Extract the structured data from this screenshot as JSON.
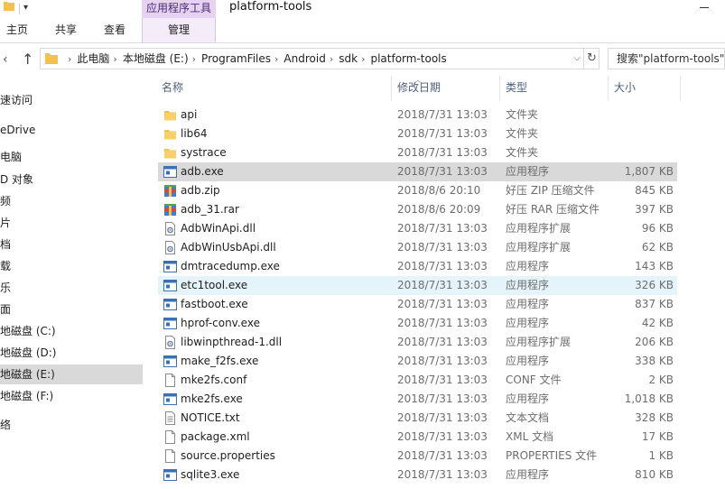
{
  "window": {
    "title": "platform-tools",
    "context_tab_header": "应用程序工具"
  },
  "ribbon": {
    "tabs": [
      "主页",
      "共享",
      "查看",
      "管理"
    ]
  },
  "address": {
    "breadcrumbs": [
      "此电脑",
      "本地磁盘 (E:)",
      "ProgramFiles",
      "Android",
      "sdk",
      "platform-tools"
    ],
    "search_placeholder": "搜索\"platform-tools\""
  },
  "nav": {
    "items": [
      {
        "label": "速访问",
        "selected": false
      },
      {
        "label": "eDrive",
        "selected": false
      },
      {
        "label": "电脑",
        "selected": false
      },
      {
        "label": "D 对象",
        "selected": false
      },
      {
        "label": "频",
        "selected": false
      },
      {
        "label": "片",
        "selected": false
      },
      {
        "label": "档",
        "selected": false
      },
      {
        "label": "载",
        "selected": false
      },
      {
        "label": "乐",
        "selected": false
      },
      {
        "label": "面",
        "selected": false
      },
      {
        "label": "地磁盘 (C:)",
        "selected": false
      },
      {
        "label": "地磁盘 (D:)",
        "selected": false
      },
      {
        "label": "地磁盘 (E:)",
        "selected": true
      },
      {
        "label": "地磁盘 (F:)",
        "selected": false
      },
      {
        "label": "络",
        "selected": false
      }
    ]
  },
  "columns": {
    "name": "名称",
    "date": "修改日期",
    "type": "类型",
    "size": "大小"
  },
  "files": [
    {
      "name": "api",
      "date": "2018/7/31 13:03",
      "type": "文件夹",
      "size": "",
      "icon": "folder-icon",
      "state": ""
    },
    {
      "name": "lib64",
      "date": "2018/7/31 13:03",
      "type": "文件夹",
      "size": "",
      "icon": "folder-icon",
      "state": ""
    },
    {
      "name": "systrace",
      "date": "2018/7/31 13:03",
      "type": "文件夹",
      "size": "",
      "icon": "folder-icon",
      "state": ""
    },
    {
      "name": "adb.exe",
      "date": "2018/7/31 13:03",
      "type": "应用程序",
      "size": "1,807 KB",
      "icon": "exe-icon",
      "state": "selected"
    },
    {
      "name": "adb.zip",
      "date": "2018/8/6 20:10",
      "type": "好压 ZIP 压缩文件",
      "size": "845 KB",
      "icon": "archive-icon",
      "state": ""
    },
    {
      "name": "adb_31.rar",
      "date": "2018/8/6 20:09",
      "type": "好压 RAR 压缩文件",
      "size": "397 KB",
      "icon": "archive-icon",
      "state": ""
    },
    {
      "name": "AdbWinApi.dll",
      "date": "2018/7/31 13:03",
      "type": "应用程序扩展",
      "size": "96 KB",
      "icon": "dll-icon",
      "state": ""
    },
    {
      "name": "AdbWinUsbApi.dll",
      "date": "2018/7/31 13:03",
      "type": "应用程序扩展",
      "size": "62 KB",
      "icon": "dll-icon",
      "state": ""
    },
    {
      "name": "dmtracedump.exe",
      "date": "2018/7/31 13:03",
      "type": "应用程序",
      "size": "143 KB",
      "icon": "exe-icon",
      "state": ""
    },
    {
      "name": "etc1tool.exe",
      "date": "2018/7/31 13:03",
      "type": "应用程序",
      "size": "326 KB",
      "icon": "exe-icon",
      "state": "hover"
    },
    {
      "name": "fastboot.exe",
      "date": "2018/7/31 13:03",
      "type": "应用程序",
      "size": "837 KB",
      "icon": "exe-icon",
      "state": ""
    },
    {
      "name": "hprof-conv.exe",
      "date": "2018/7/31 13:03",
      "type": "应用程序",
      "size": "42 KB",
      "icon": "exe-icon",
      "state": ""
    },
    {
      "name": "libwinpthread-1.dll",
      "date": "2018/7/31 13:03",
      "type": "应用程序扩展",
      "size": "206 KB",
      "icon": "dll-icon",
      "state": ""
    },
    {
      "name": "make_f2fs.exe",
      "date": "2018/7/31 13:03",
      "type": "应用程序",
      "size": "338 KB",
      "icon": "exe-icon",
      "state": ""
    },
    {
      "name": "mke2fs.conf",
      "date": "2018/7/31 13:03",
      "type": "CONF 文件",
      "size": "2 KB",
      "icon": "file-icon",
      "state": ""
    },
    {
      "name": "mke2fs.exe",
      "date": "2018/7/31 13:03",
      "type": "应用程序",
      "size": "1,018 KB",
      "icon": "exe-icon",
      "state": ""
    },
    {
      "name": "NOTICE.txt",
      "date": "2018/7/31 13:03",
      "type": "文本文档",
      "size": "328 KB",
      "icon": "text-file-icon",
      "state": ""
    },
    {
      "name": "package.xml",
      "date": "2018/7/31 13:03",
      "type": "XML 文档",
      "size": "17 KB",
      "icon": "file-icon",
      "state": ""
    },
    {
      "name": "source.properties",
      "date": "2018/7/31 13:03",
      "type": "PROPERTIES 文件",
      "size": "1 KB",
      "icon": "file-icon",
      "state": ""
    },
    {
      "name": "sqlite3.exe",
      "date": "2018/7/31 13:03",
      "type": "应用程序",
      "size": "810 KB",
      "icon": "exe-icon",
      "state": ""
    }
  ],
  "colors": {
    "selected_row": "#d9d9d9",
    "hover_row": "#e5f3fb",
    "context_tab": "#e7d3f1",
    "folder": "#f2c14e"
  }
}
